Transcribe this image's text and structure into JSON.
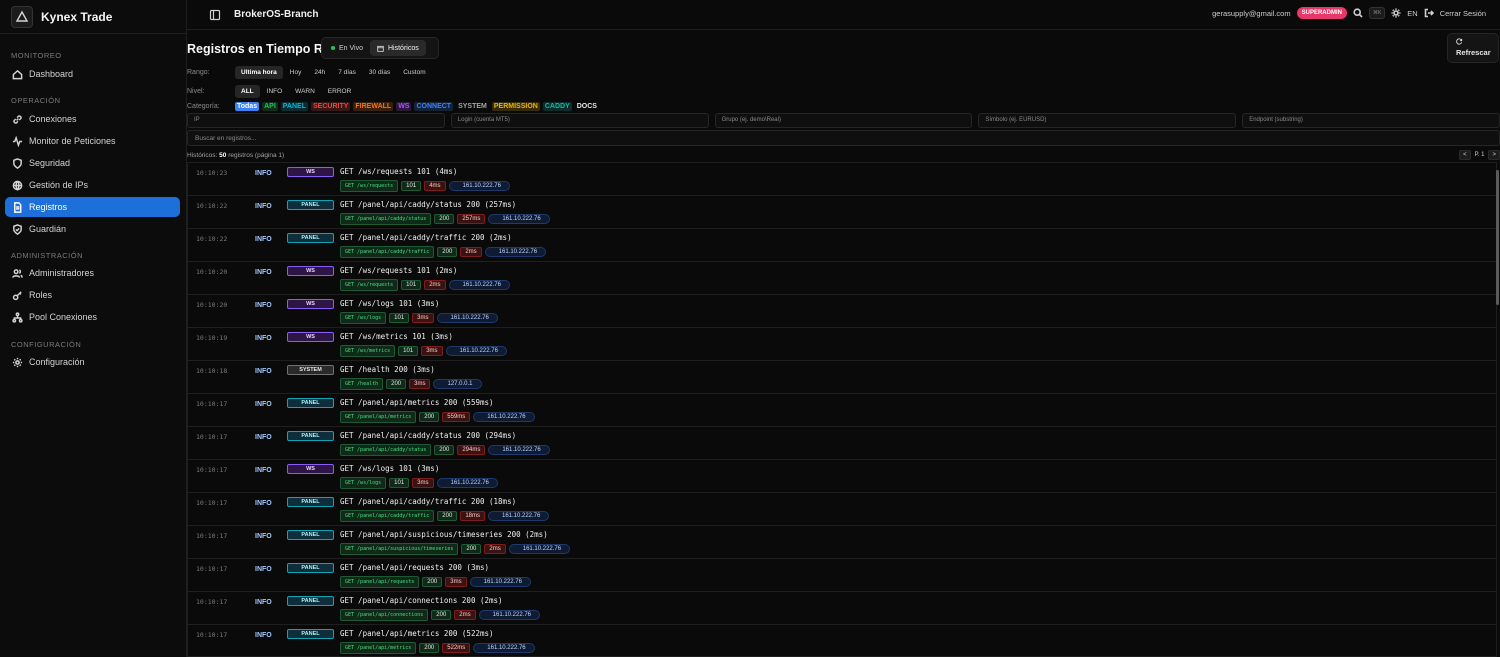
{
  "brand": {
    "name": "Kynex Trade"
  },
  "sidebar": {
    "sections": [
      {
        "title": "MONITOREO"
      },
      {
        "title": "OPERACIÓN"
      },
      {
        "title": "ADMINISTRACIÓN"
      },
      {
        "title": "CONFIGURACIÓN"
      }
    ],
    "items": [
      {
        "label": "Dashboard",
        "icon": "home-icon"
      },
      {
        "label": "Conexiones",
        "icon": "link-icon"
      },
      {
        "label": "Monitor de Peticiones",
        "icon": "activity-icon"
      },
      {
        "label": "Seguridad",
        "icon": "shield-icon"
      },
      {
        "label": "Gestión de IPs",
        "icon": "globe-icon"
      },
      {
        "label": "Registros",
        "icon": "file-icon",
        "active": true
      },
      {
        "label": "Guardián",
        "icon": "shield-check-icon"
      },
      {
        "label": "Administradores",
        "icon": "users-icon"
      },
      {
        "label": "Roles",
        "icon": "key-icon"
      },
      {
        "label": "Pool Conexiones",
        "icon": "network-icon"
      },
      {
        "label": "Configuración",
        "icon": "gear-icon"
      }
    ]
  },
  "header": {
    "title": "BrokerOS-Branch",
    "email": "gerasupply@gmail.com",
    "role": "SUPERADMIN",
    "kbd": "⌘K",
    "lang": "EN",
    "logout": "Cerrar Sesión"
  },
  "page": {
    "title": "Registros en Tiempo Real",
    "mode_live": "En Vivo",
    "mode_history": "Históricos",
    "refresh": "Refrescar"
  },
  "filters": {
    "range_label": "Rango:",
    "ranges": [
      "Ultima hora",
      "Hoy",
      "24h",
      "7 días",
      "30 días",
      "Custom"
    ],
    "level_label": "Nivel:",
    "levels": [
      "ALL",
      "INFO",
      "WARN",
      "ERROR"
    ],
    "category_label": "Categoría:",
    "categories": [
      {
        "label": "Todas",
        "color": "#3b82f6"
      },
      {
        "label": "API",
        "color": "#22c55e"
      },
      {
        "label": "PANEL",
        "color": "#06b6d4"
      },
      {
        "label": "SECURITY",
        "color": "#ef4444"
      },
      {
        "label": "FIREWALL",
        "color": "#f97316"
      },
      {
        "label": "WS",
        "color": "#a855f7"
      },
      {
        "label": "CONNECT",
        "color": "#3b82f6"
      },
      {
        "label": "SYSTEM",
        "color": "#a3a3a3"
      },
      {
        "label": "PERMISSION",
        "color": "#eab308"
      },
      {
        "label": "CADDY",
        "color": "#14b8a6"
      },
      {
        "label": "DOCS",
        "color": "#e5e5e5"
      }
    ],
    "ip_placeholder": "IP",
    "login_placeholder": "Login (cuenta MT5)",
    "group_placeholder": "Grupo (ej. demo\\Real)",
    "symbol_placeholder": "Símbolo (ej. EURUSD)",
    "endpoint_placeholder": "Endpoint (substring)",
    "search_placeholder": "Buscar en registros..."
  },
  "history": {
    "prefix": "Históricos:",
    "count": "50",
    "suffix": "registros (página 1)",
    "prev": "<",
    "page": "P. 1",
    "next": ">"
  },
  "logs": [
    {
      "time": "10:10:23",
      "level": "INFO",
      "cat": "WS",
      "msg": "GET /ws/requests 101 (4ms)",
      "method": "GET",
      "endpoint": "/ws/requests",
      "status": "101",
      "ms": "4ms",
      "ip": "161.10.222.76"
    },
    {
      "time": "10:10:22",
      "level": "INFO",
      "cat": "PANEL",
      "msg": "GET /panel/api/caddy/status 200 (257ms)",
      "method": "GET",
      "endpoint": "/panel/api/caddy/status",
      "status": "200",
      "ms": "257ms",
      "ip": "161.10.222.76"
    },
    {
      "time": "10:10:22",
      "level": "INFO",
      "cat": "PANEL",
      "msg": "GET /panel/api/caddy/traffic 200 (2ms)",
      "method": "GET",
      "endpoint": "/panel/api/caddy/traffic",
      "status": "200",
      "ms": "2ms",
      "ip": "161.10.222.76"
    },
    {
      "time": "10:10:20",
      "level": "INFO",
      "cat": "WS",
      "msg": "GET /ws/requests 101 (2ms)",
      "method": "GET",
      "endpoint": "/ws/requests",
      "status": "101",
      "ms": "2ms",
      "ip": "161.10.222.76"
    },
    {
      "time": "10:10:20",
      "level": "INFO",
      "cat": "WS",
      "msg": "GET /ws/logs 101 (3ms)",
      "method": "GET",
      "endpoint": "/ws/logs",
      "status": "101",
      "ms": "3ms",
      "ip": "161.10.222.76"
    },
    {
      "time": "10:10:19",
      "level": "INFO",
      "cat": "WS",
      "msg": "GET /ws/metrics 101 (3ms)",
      "method": "GET",
      "endpoint": "/ws/metrics",
      "status": "101",
      "ms": "3ms",
      "ip": "161.10.222.76"
    },
    {
      "time": "10:10:18",
      "level": "INFO",
      "cat": "SYSTEM",
      "msg": "GET /health 200 (3ms)",
      "method": "GET",
      "endpoint": "/health",
      "status": "200",
      "ms": "3ms",
      "ip": "127.0.0.1"
    },
    {
      "time": "10:10:17",
      "level": "INFO",
      "cat": "PANEL",
      "msg": "GET /panel/api/metrics 200 (559ms)",
      "method": "GET",
      "endpoint": "/panel/api/metrics",
      "status": "200",
      "ms": "559ms",
      "ip": "161.10.222.76"
    },
    {
      "time": "10:10:17",
      "level": "INFO",
      "cat": "PANEL",
      "msg": "GET /panel/api/caddy/status 200 (294ms)",
      "method": "GET",
      "endpoint": "/panel/api/caddy/status",
      "status": "200",
      "ms": "294ms",
      "ip": "161.10.222.76"
    },
    {
      "time": "10:10:17",
      "level": "INFO",
      "cat": "WS",
      "msg": "GET /ws/logs 101 (3ms)",
      "method": "GET",
      "endpoint": "/ws/logs",
      "status": "101",
      "ms": "3ms",
      "ip": "161.10.222.76"
    },
    {
      "time": "10:10:17",
      "level": "INFO",
      "cat": "PANEL",
      "msg": "GET /panel/api/caddy/traffic 200 (18ms)",
      "method": "GET",
      "endpoint": "/panel/api/caddy/traffic",
      "status": "200",
      "ms": "18ms",
      "ip": "161.10.222.76"
    },
    {
      "time": "10:10:17",
      "level": "INFO",
      "cat": "PANEL",
      "msg": "GET /panel/api/suspicious/timeseries 200 (2ms)",
      "method": "GET",
      "endpoint": "/panel/api/suspicious/timeseries",
      "status": "200",
      "ms": "2ms",
      "ip": "161.10.222.76"
    },
    {
      "time": "10:10:17",
      "level": "INFO",
      "cat": "PANEL",
      "msg": "GET /panel/api/requests 200 (3ms)",
      "method": "GET",
      "endpoint": "/panel/api/requests",
      "status": "200",
      "ms": "3ms",
      "ip": "161.10.222.76"
    },
    {
      "time": "10:10:17",
      "level": "INFO",
      "cat": "PANEL",
      "msg": "GET /panel/api/connections 200 (2ms)",
      "method": "GET",
      "endpoint": "/panel/api/connections",
      "status": "200",
      "ms": "2ms",
      "ip": "161.10.222.76"
    },
    {
      "time": "10:10:17",
      "level": "INFO",
      "cat": "PANEL",
      "msg": "GET /panel/api/metrics 200 (522ms)",
      "method": "GET",
      "endpoint": "/panel/api/metrics",
      "status": "200",
      "ms": "522ms",
      "ip": "161.10.222.76"
    }
  ]
}
